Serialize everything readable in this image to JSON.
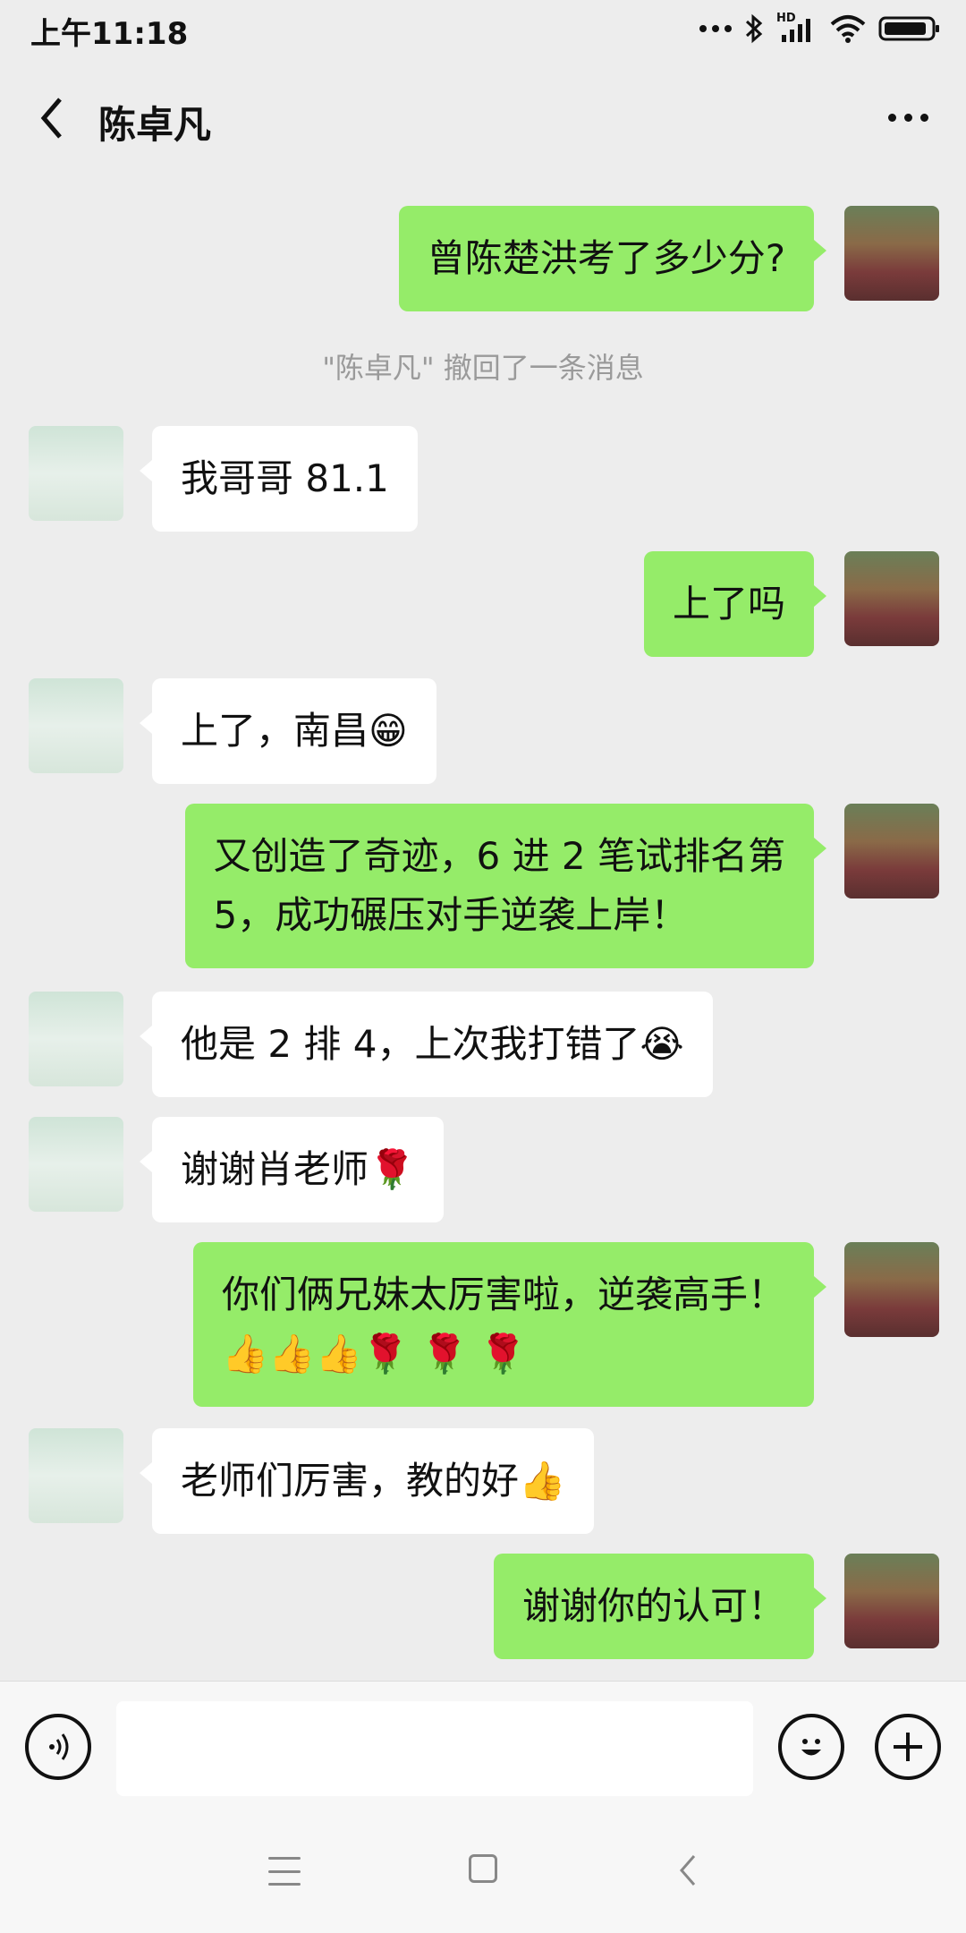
{
  "status_bar": {
    "time": "上午11:18",
    "hd_label": "HD"
  },
  "header": {
    "title": "陈卓凡"
  },
  "messages": [
    {
      "side": "right",
      "text": "曾陈楚洪考了多少分?"
    },
    {
      "system": "\"陈卓凡\" 撤回了一条消息"
    },
    {
      "side": "left",
      "text": "我哥哥 81.1"
    },
    {
      "side": "right",
      "text": "上了吗"
    },
    {
      "side": "left",
      "text": "上了，南昌😁"
    },
    {
      "side": "right",
      "text": "又创造了奇迹，6 进 2 笔试排名第\n5，成功碾压对手逆袭上岸！"
    },
    {
      "side": "left",
      "text": "他是 2 排 4，上次我打错了😭"
    },
    {
      "side": "left",
      "text": "谢谢肖老师🌹"
    },
    {
      "side": "right",
      "text": "你们俩兄妹太厉害啦，逆袭高手！\n👍👍👍🌹 🌹 🌹"
    },
    {
      "side": "left",
      "text": "老师们厉害，教的好👍"
    },
    {
      "side": "right",
      "text": "谢谢你的认可！"
    }
  ],
  "icons": {
    "back": "chevron-left-icon",
    "more": "more-dots-icon",
    "voice": "voice-icon",
    "emoji": "emoji-icon",
    "plus": "plus-icon"
  },
  "colors": {
    "sent_bubble": "#95ec69",
    "received_bubble": "#ffffff",
    "background": "#ededed"
  }
}
